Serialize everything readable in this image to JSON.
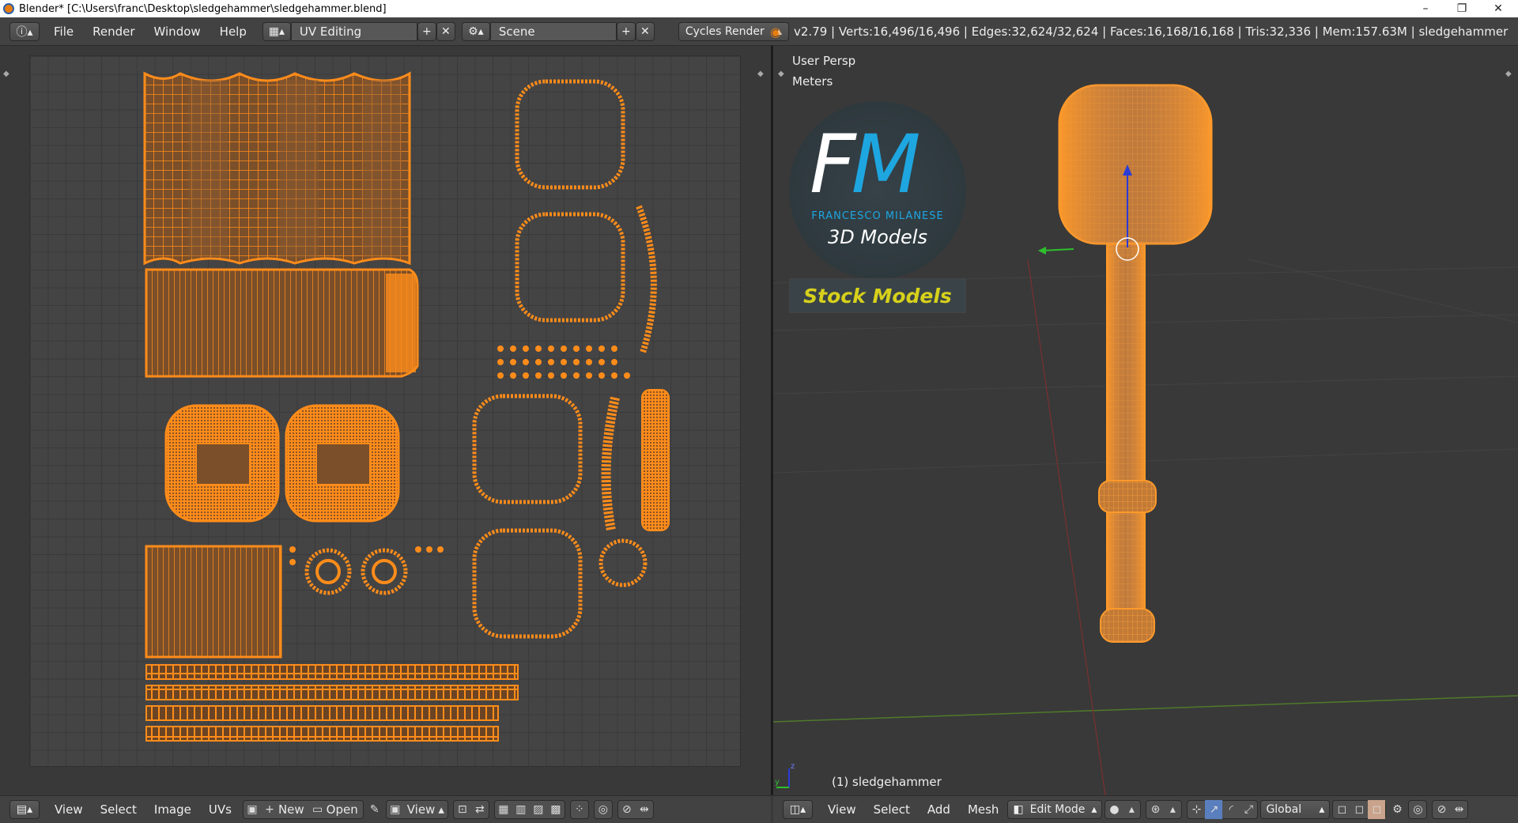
{
  "window": {
    "title": "Blender* [C:\\Users\\franc\\Desktop\\sledgehammer\\sledgehammer.blend]",
    "minimize": "–",
    "restore": "❐",
    "close": "✕"
  },
  "header": {
    "menus": [
      "File",
      "Render",
      "Window",
      "Help"
    ],
    "screen_layout": "UV Editing",
    "scene": "Scene",
    "engine": "Cycles Render",
    "stats": "v2.79 | Verts:16,496/16,496 | Edges:32,624/32,624 | Faces:16,168/16,168 | Tris:32,336 | Mem:157.63M | sledgehammer"
  },
  "viewport": {
    "view_name": "User Persp",
    "units": "Meters",
    "object_label": "(1) sledgehammer"
  },
  "logo": {
    "initial_f": "F",
    "initial_m": "M",
    "name": "FRANCESCO MILANESE",
    "models": "3D Models",
    "stock": "Stock Models"
  },
  "uv_footer": {
    "view": "View",
    "select": "Select",
    "image": "Image",
    "uvs": "UVs",
    "new": "New",
    "open": "Open",
    "view2": "View"
  },
  "vp_footer": {
    "view": "View",
    "select": "Select",
    "add": "Add",
    "mesh": "Mesh",
    "mode": "Edit Mode",
    "orientation": "Global"
  },
  "colors": {
    "accent": "#ff8c1a",
    "bg": "#393939",
    "header": "#424242"
  }
}
